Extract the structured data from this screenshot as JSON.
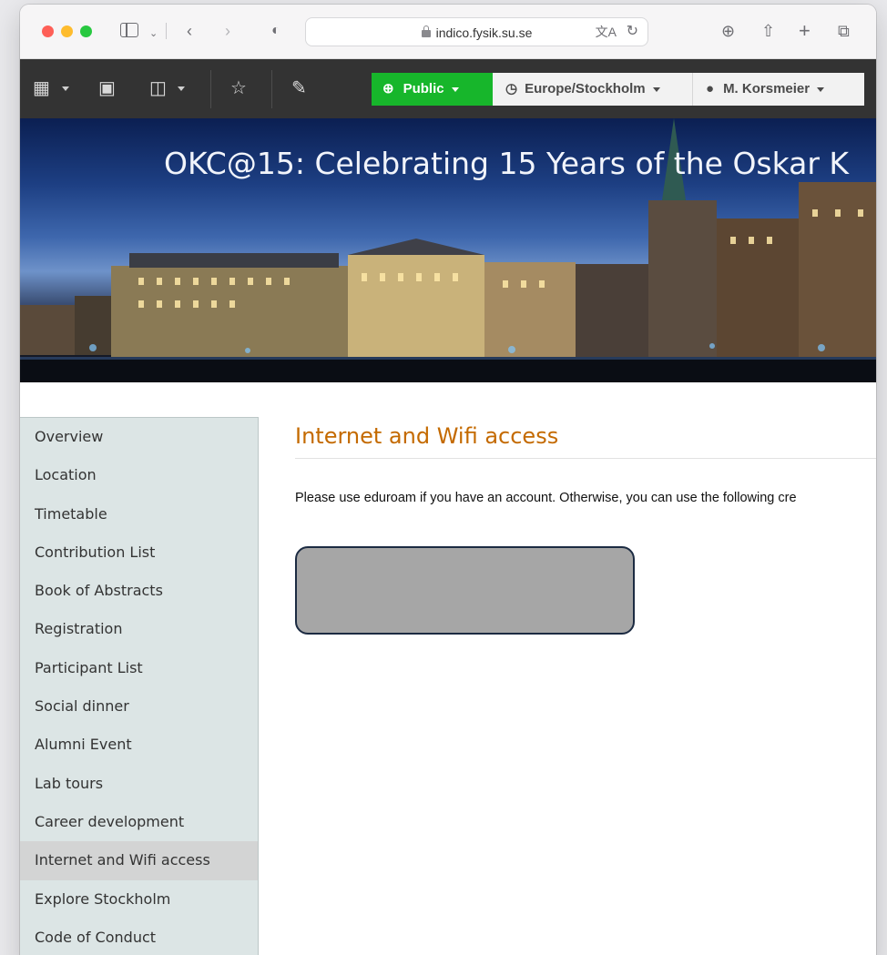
{
  "browser": {
    "url": "indico.fysik.su.se"
  },
  "toolbar": {
    "visibility_label": "Public",
    "timezone_label": "Europe/Stockholm",
    "user_label": "M. Korsmeier",
    "visibility_color": "#17b62b"
  },
  "banner": {
    "title": "OKC@15: Celebrating 15 Years of the Oskar K"
  },
  "sidebar": {
    "items": [
      {
        "label": "Overview"
      },
      {
        "label": "Location"
      },
      {
        "label": "Timetable"
      },
      {
        "label": "Contribution List"
      },
      {
        "label": "Book of Abstracts"
      },
      {
        "label": "Registration"
      },
      {
        "label": "Participant List"
      },
      {
        "label": "Social dinner"
      },
      {
        "label": "Alumni Event"
      },
      {
        "label": "Lab tours"
      },
      {
        "label": "Career development"
      },
      {
        "label": "Internet and Wifi access"
      },
      {
        "label": "Explore Stockholm"
      },
      {
        "label": "Code of Conduct"
      }
    ]
  },
  "main": {
    "title": "Internet and Wifi access",
    "body": "Please use eduroam if you have an account. Otherwise, you can use the following cre"
  },
  "colors": {
    "title": "#c46a00",
    "sidebar_bg": "#dce5e5",
    "toolbar_bg": "#333333"
  }
}
